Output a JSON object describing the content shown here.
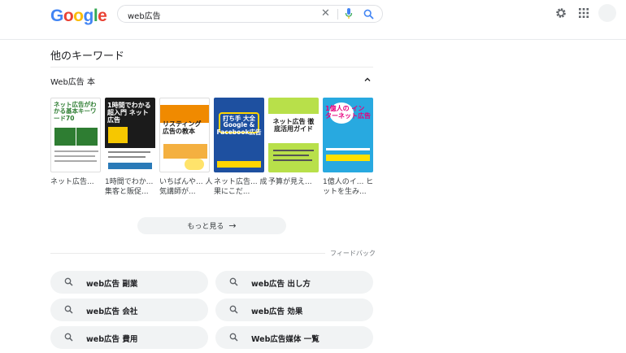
{
  "header": {
    "logo": [
      "G",
      "o",
      "o",
      "g",
      "l",
      "e"
    ],
    "logo_colors": [
      "#4285F4",
      "#EA4335",
      "#FBBC05",
      "#4285F4",
      "#34A853",
      "#EA4335"
    ],
    "query": "web広告"
  },
  "section": {
    "title": "他のキーワード",
    "subtitle": "Web広告 本"
  },
  "books": [
    {
      "title": "ネット広告...",
      "cover_bg": "#ffffff",
      "cover_text": "ネット広告がわかる基本キーワード70",
      "cover_accent": "#2e7d32"
    },
    {
      "title": "1時間でわか... 集客と販促...",
      "cover_bg": "#1b1b1b",
      "cover_text": "1時間でわかる 超入門 ネット広告",
      "cover_accent": "#f6c700"
    },
    {
      "title": "いちばんや... 人気講師が...",
      "cover_bg": "#ffffff",
      "cover_text": "リスティング広告の教本",
      "cover_accent": "#f08a00"
    },
    {
      "title": "ネット広告... 成果にこだ...",
      "cover_bg": "#1e50a0",
      "cover_text": "打ち手 大全 Google & Facebook広告",
      "cover_accent": "#ffd400"
    },
    {
      "title": "予算が見え...",
      "cover_bg": "#b8e04a",
      "cover_text": "ネット広告 徹底活用ガイド",
      "cover_accent": "#222222"
    },
    {
      "title": "1億人のイ... ヒットを生み...",
      "cover_bg": "#28a9e0",
      "cover_text": "1億人の インターネット広告",
      "cover_accent": "#ffffff"
    }
  ],
  "more_button": "もっと見る",
  "feedback": "フィードバック",
  "related": [
    "web広告 副業",
    "web広告 出し方",
    "web広告 会社",
    "web広告 効果",
    "web広告 費用",
    "Web広告媒体 一覧"
  ]
}
